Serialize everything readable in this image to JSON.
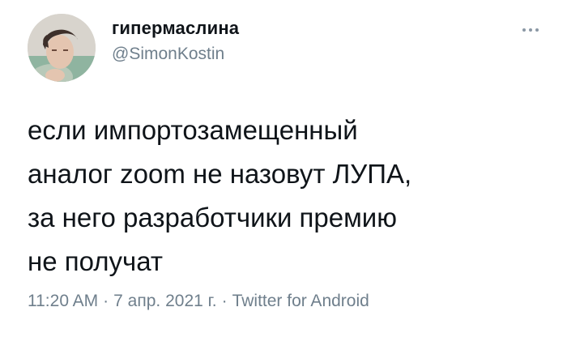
{
  "author": {
    "display_name": "гипермаслина",
    "handle": "@SimonKostin",
    "avatar_icon": "profile-photo"
  },
  "tweet": {
    "text": "если импортозамещенный\nаналог zoom не назовут ЛУПА,\nза него разработчики премию\nне получат",
    "time": "11:20 AM",
    "date": "7 апр. 2021 г.",
    "source": "Twitter for Android",
    "separator": "·"
  },
  "menu": {
    "icon": "more-options-icon"
  },
  "colors": {
    "text_primary": "#0f1419",
    "text_secondary": "#6f7f8c",
    "background": "#ffffff"
  }
}
